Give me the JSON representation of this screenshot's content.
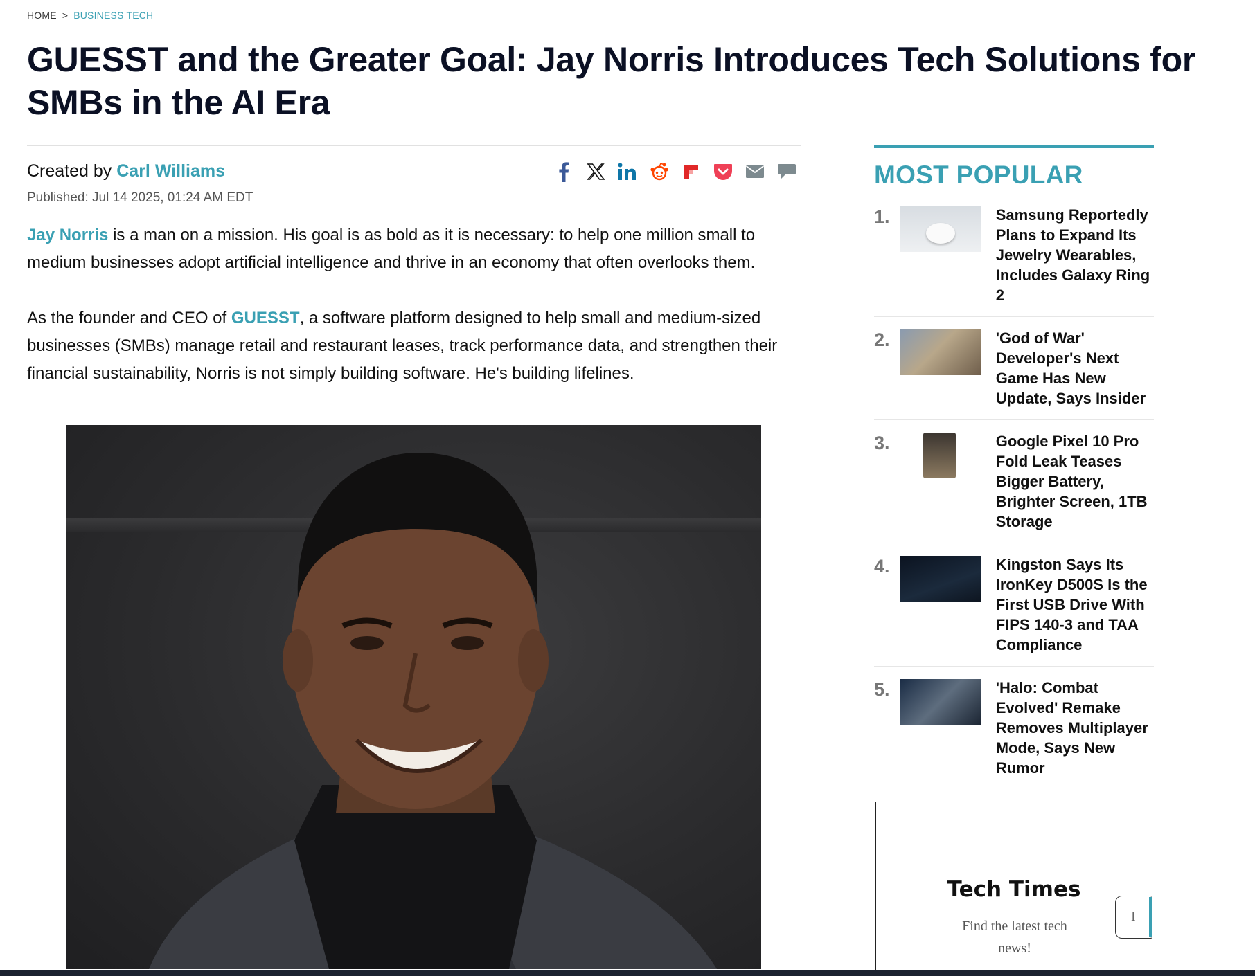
{
  "breadcrumb": {
    "home": "HOME",
    "separator": ">",
    "section": "BUSINESS TECH"
  },
  "headline": "GUESST and the Greater Goal: Jay Norris Introduces Tech Solutions for SMBs in the AI Era",
  "byline": {
    "prefix": "Created by",
    "author": "Carl Williams",
    "published": "Published: Jul 14 2025, 01:24 AM EDT"
  },
  "share_icons": [
    "facebook-icon",
    "x-icon",
    "linkedin-icon",
    "reddit-icon",
    "flipboard-icon",
    "pocket-icon",
    "email-icon",
    "comment-icon"
  ],
  "article": {
    "p1_link": "Jay Norris",
    "p1_text": " is a man on a mission. His goal is as bold as it is necessary: to help one million small to medium businesses adopt artificial intelligence and thrive in an economy that often overlooks them.",
    "p2_before": "As the founder and CEO of ",
    "p2_link": "GUESST",
    "p2_after": ", a software platform designed to help small and medium-sized businesses (SMBs) manage retail and restaurant leases, track performance data, and strengthen their financial sustainability, Norris is not simply building software. He's building lifelines."
  },
  "sidebar": {
    "title": "MOST POPULAR",
    "items": [
      {
        "num": "1.",
        "title": "Samsung Reportedly Plans to Expand Its Jewelry Wearables, Includes Galaxy Ring 2"
      },
      {
        "num": "2.",
        "title": "'God of War' Developer's Next Game Has New Update, Says Insider"
      },
      {
        "num": "3.",
        "title": "Google Pixel 10 Pro Fold Leak Teases Bigger Battery, Brighter Screen, 1TB Storage"
      },
      {
        "num": "4.",
        "title": "Kingston Says Its IronKey D500S Is the First USB Drive With FIPS 140-3 and TAA Compliance"
      },
      {
        "num": "5.",
        "title": "'Halo: Combat Evolved' Remake Removes Multiplayer Mode, Says New Rumor"
      }
    ]
  },
  "newsletter": {
    "title": "Tech Times",
    "subtitle": "Find the latest tech news!",
    "input_placeholder": "I"
  },
  "colors": {
    "accent": "#3aa0b3",
    "headline": "#0b1024",
    "facebook": "#3b5998",
    "linkedin": "#0e76a8",
    "reddit": "#ff4500",
    "flipboard": "#e12828",
    "pocket": "#ef4056",
    "muted_icon": "#7d8a8f"
  }
}
